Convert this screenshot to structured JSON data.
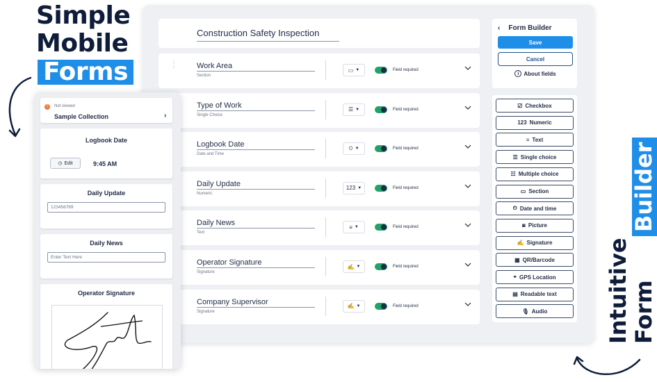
{
  "headline": {
    "line1": "Simple",
    "line2": "Mobile",
    "line3": "Forms"
  },
  "vertical_title": {
    "line1": "Intuitive",
    "line2": "Form ",
    "line3": "Builder"
  },
  "colors": {
    "accent": "#1e8ee8",
    "navy": "#0f1d3a",
    "toggle": "#20a36a",
    "badge": "#f07a3a"
  },
  "builder": {
    "form_title": "Construction Safety Inspection",
    "required_label": "Field required",
    "rows": [
      {
        "title": "Work Area",
        "subtitle": "Section",
        "type_icon": "section-icon",
        "type_glyph": "▭"
      },
      {
        "title": "Type of Work",
        "subtitle": "Single Choice",
        "type_icon": "single-choice-icon",
        "type_glyph": "☰"
      },
      {
        "title": "Logbook Date",
        "subtitle": "Date and Time",
        "type_icon": "date-time-icon",
        "type_glyph": "⏲"
      },
      {
        "title": "Daily Update",
        "subtitle": "Numeric",
        "type_icon": "numeric-icon",
        "type_glyph": "123"
      },
      {
        "title": "Daily News",
        "subtitle": "Text",
        "type_icon": "text-icon",
        "type_glyph": "≡"
      },
      {
        "title": "Operator Signature",
        "subtitle": "Signature",
        "type_icon": "signature-icon",
        "type_glyph": "✍"
      },
      {
        "title": "Company Supervisor",
        "subtitle": "Signature",
        "type_icon": "signature-icon",
        "type_glyph": "✍"
      }
    ]
  },
  "side_panel": {
    "title": "Form Builder",
    "save": "Save",
    "cancel": "Cancel",
    "about": "About fields"
  },
  "palette": [
    {
      "label": "Checkbox",
      "icon": "checkbox-icon",
      "glyph": "☑"
    },
    {
      "label": "Numeric",
      "icon": "numeric-icon",
      "glyph": "123"
    },
    {
      "label": "Text",
      "icon": "text-icon",
      "glyph": "≡"
    },
    {
      "label": "Single choice",
      "icon": "single-choice-icon",
      "glyph": "☰"
    },
    {
      "label": "Multiple choice",
      "icon": "multiple-choice-icon",
      "glyph": "☷"
    },
    {
      "label": "Section",
      "icon": "section-icon",
      "glyph": "▭"
    },
    {
      "label": "Date and time",
      "icon": "date-time-icon",
      "glyph": "⏲"
    },
    {
      "label": "Picture",
      "icon": "camera-icon",
      "glyph": "◙"
    },
    {
      "label": "Signature",
      "icon": "signature-icon",
      "glyph": "✍"
    },
    {
      "label": "QR/Barcode",
      "icon": "qr-icon",
      "glyph": "▦"
    },
    {
      "label": "GPS Location",
      "icon": "location-icon",
      "glyph": "⌖"
    },
    {
      "label": "Readable text",
      "icon": "readable-text-icon",
      "glyph": "▤"
    },
    {
      "label": "Audio",
      "icon": "microphone-icon",
      "glyph": "🎙"
    }
  ],
  "mobile": {
    "status": "Not viewed",
    "collection": "Sample Collection",
    "logbook_title": "Logbook Date",
    "edit": "Edit",
    "time": "9:45 AM",
    "daily_update_title": "Daily Update",
    "daily_update_value": "123456789",
    "daily_news_title": "Daily News",
    "daily_news_placeholder": "Enter Text Here",
    "signature_title": "Operator Signature"
  }
}
